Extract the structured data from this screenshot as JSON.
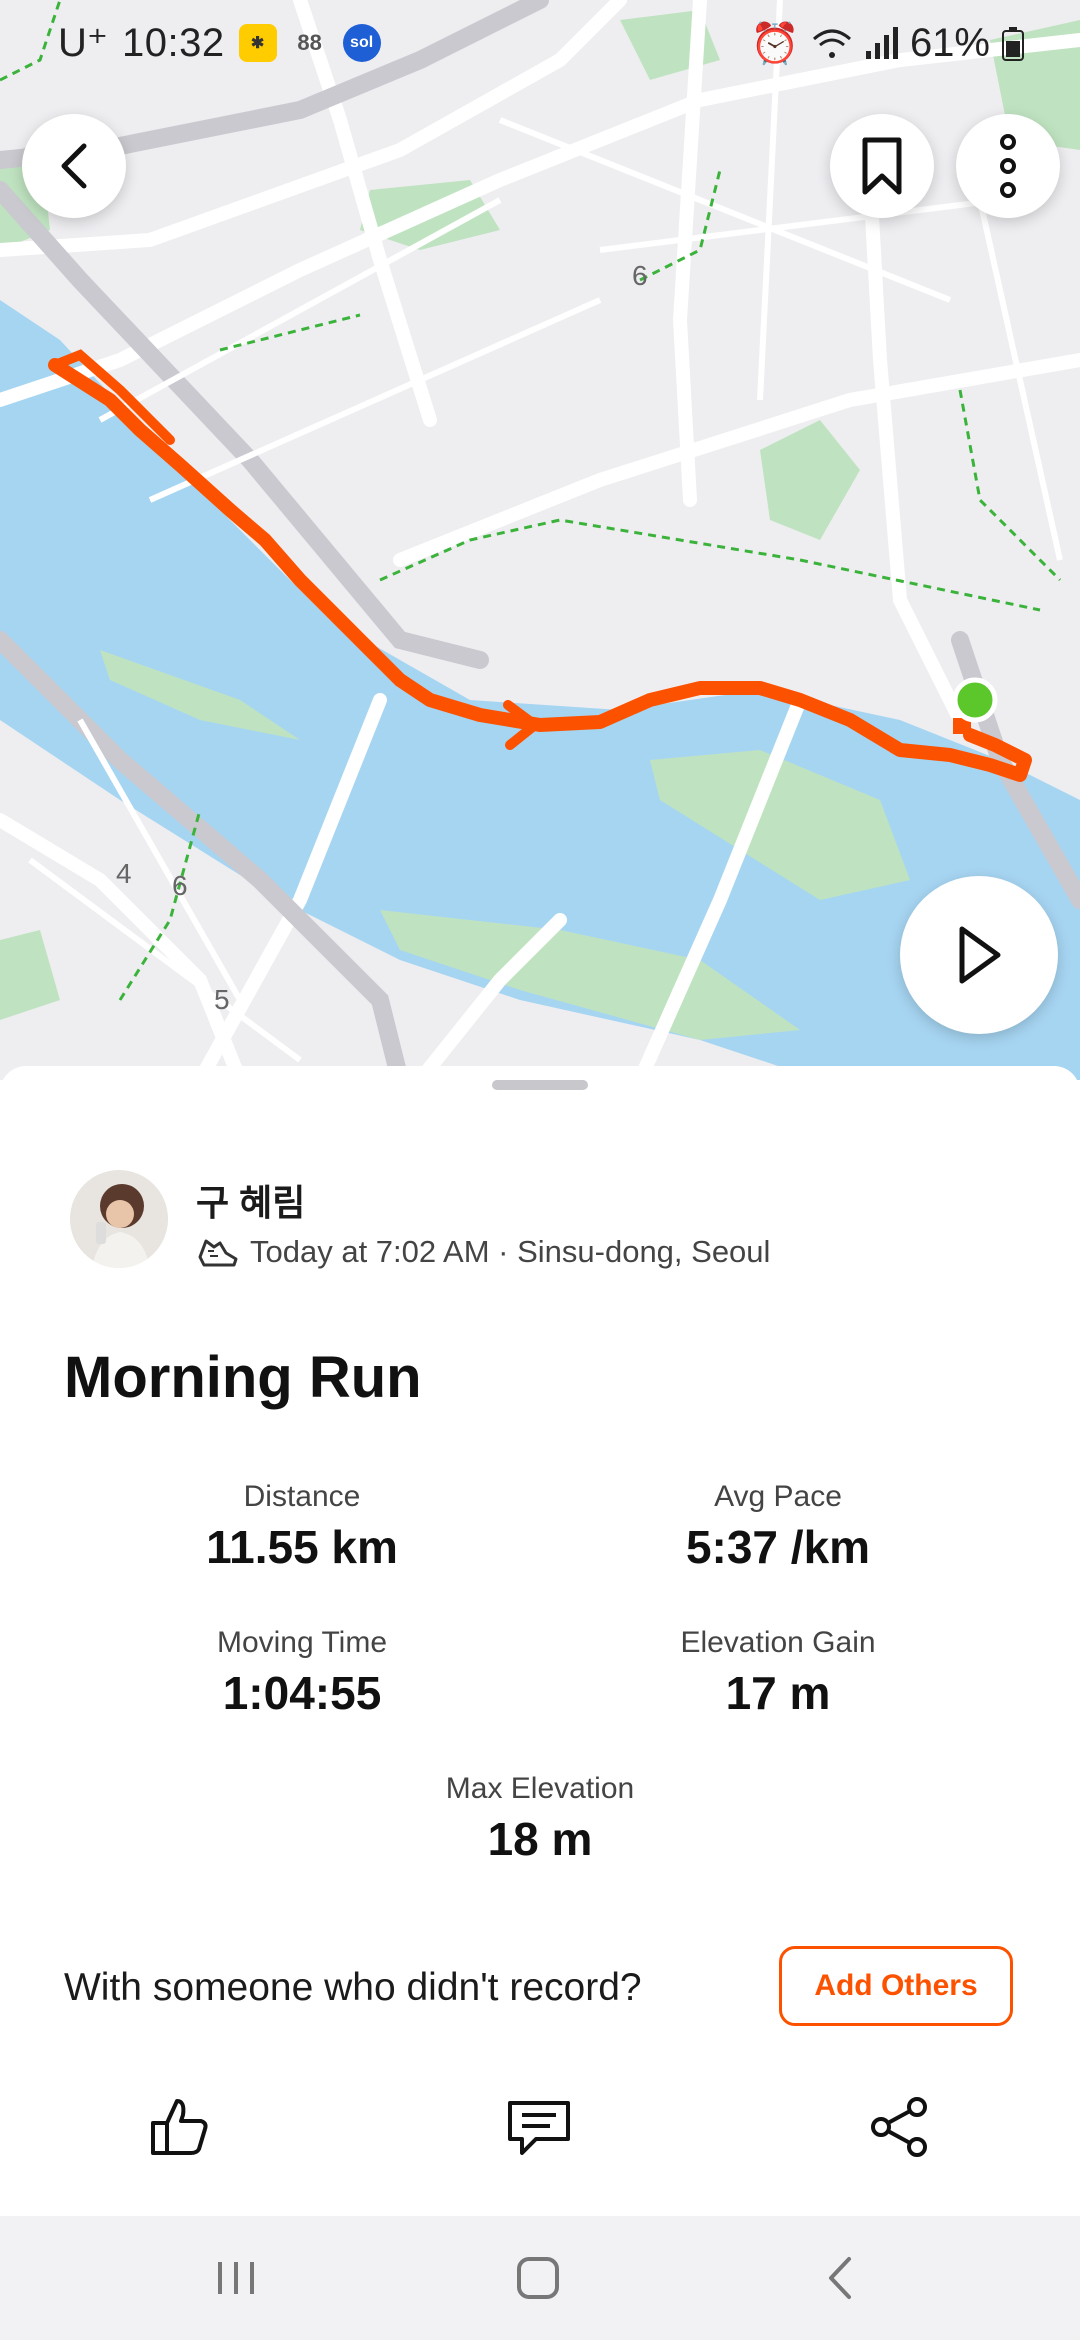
{
  "status_bar": {
    "carrier": "U⁺",
    "time": "10:32",
    "battery": "61%"
  },
  "map": {
    "labels": [
      "6",
      "4",
      "6",
      "5"
    ],
    "route_color": "#fc5200",
    "water_color": "#a6d5f2",
    "park_color": "#bfe3c0"
  },
  "buttons": {
    "back_icon": "chevron-left-icon",
    "bookmark_icon": "bookmark-icon",
    "more_icon": "more-vertical-icon",
    "play_icon": "play-icon"
  },
  "activity": {
    "athlete": "구 혜림",
    "meta": "Today at 7:02 AM · Sinsu-dong, Seoul",
    "title": "Morning Run",
    "stats": [
      {
        "label": "Distance",
        "value": "11.55 km"
      },
      {
        "label": "Avg Pace",
        "value": "5:37 /km"
      },
      {
        "label": "Moving Time",
        "value": "1:04:55"
      },
      {
        "label": "Elevation Gain",
        "value": "17 m"
      },
      {
        "label": "Max Elevation",
        "value": "18 m"
      }
    ]
  },
  "prompt": {
    "text": "With someone who didn't record?",
    "button": "Add Others"
  },
  "actions": [
    "like-icon",
    "comment-icon",
    "share-icon"
  ],
  "accent_color": "#fc5200"
}
